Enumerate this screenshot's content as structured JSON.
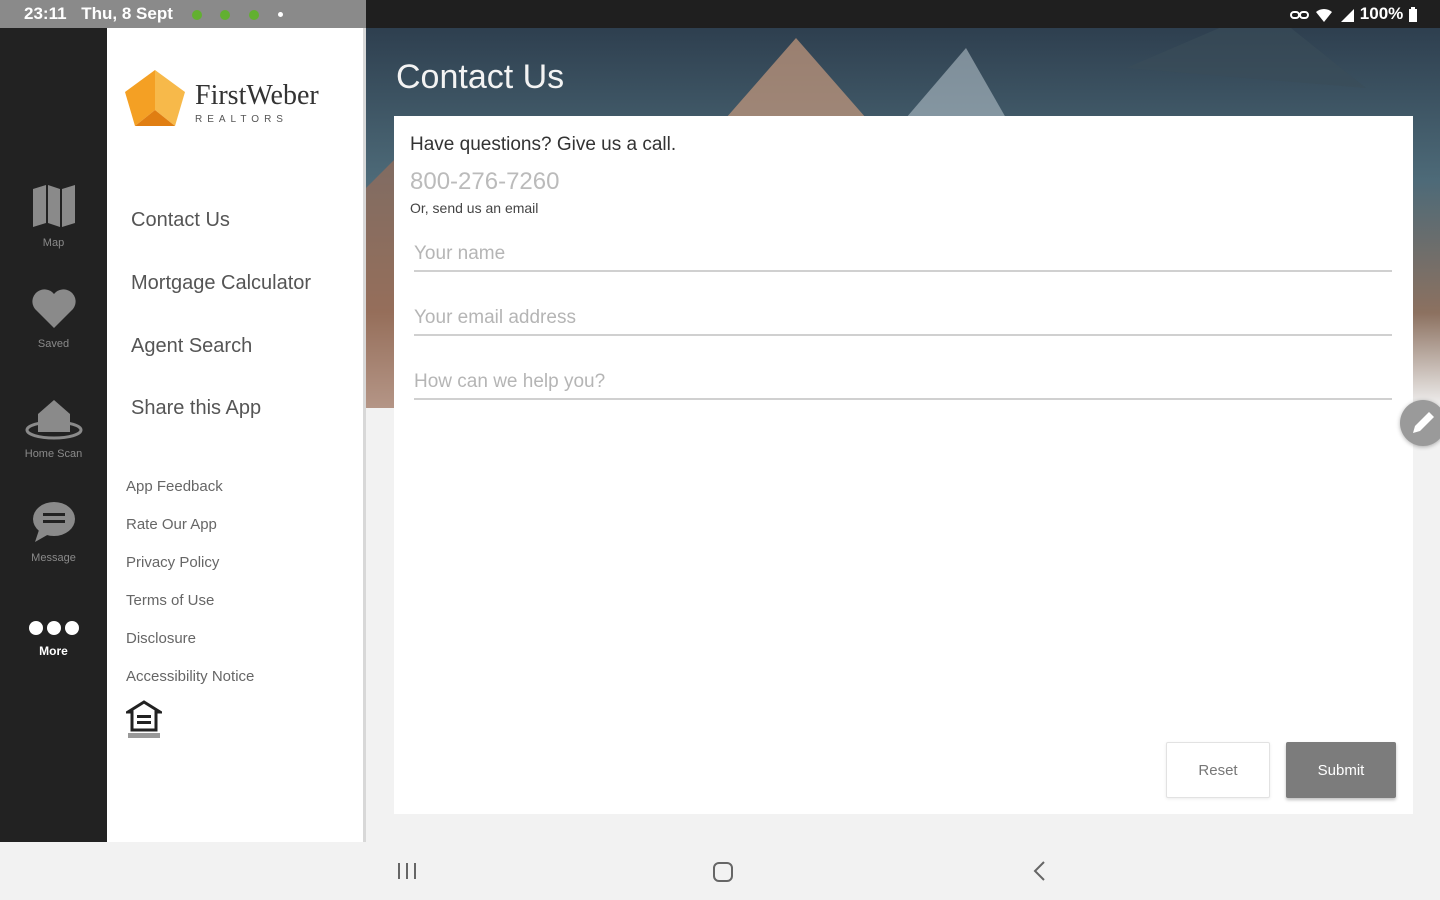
{
  "status_bar": {
    "time": "23:11",
    "date": "Thu, 8 Sept",
    "battery": "100%"
  },
  "rail": {
    "items": [
      {
        "label": "Map",
        "icon": "map-icon"
      },
      {
        "label": "Saved",
        "icon": "heart-icon"
      },
      {
        "label": "Home Scan",
        "icon": "home-scan-icon"
      },
      {
        "label": "Message",
        "icon": "chat-bubble-icon"
      },
      {
        "label": "More",
        "icon": "more-dots-icon"
      }
    ],
    "active": "More"
  },
  "menu": {
    "logo_text": "FirstWeber",
    "logo_sub": "REALTORS",
    "main_items": [
      "Contact Us",
      "Mortgage Calculator",
      "Agent Search",
      "Share this App"
    ],
    "small_items": [
      "App Feedback",
      "Rate Our App",
      "Privacy Policy",
      "Terms of Use",
      "Disclosure",
      "Accessibility Notice"
    ],
    "footer_icon": "equal-housing-opportunity-icon"
  },
  "page": {
    "title": "Contact Us"
  },
  "contact_form": {
    "question": "Have questions? Give us a call.",
    "phone": "800-276-7260",
    "or_email": "Or, send us an email",
    "name_placeholder": "Your name",
    "email_placeholder": "Your email address",
    "message_placeholder": "How can we help you?",
    "reset_label": "Reset",
    "submit_label": "Submit"
  },
  "colors": {
    "logo_orange": "#f4a024",
    "rail_bg": "#222222",
    "submit_bg": "#7c7c7c"
  }
}
